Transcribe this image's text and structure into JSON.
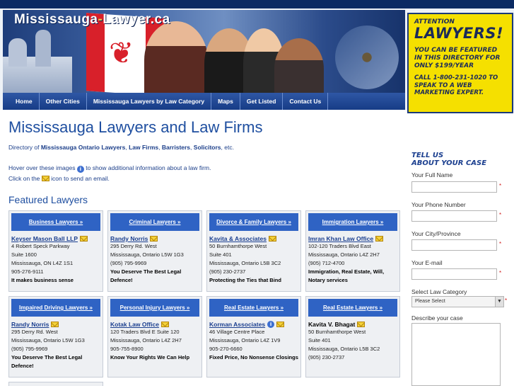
{
  "header": {
    "logo_main": "Mississauga",
    "logo_dash": "-",
    "logo_tail": "Lawyer.ca"
  },
  "ad": {
    "line1": "ATTENTION",
    "line2": "LAWYERS!",
    "line3": "YOU CAN BE FEATURED IN THIS DIRECTORY FOR ONLY $199/YEAR",
    "line4": "CALL 1-800-231-1020 TO SPEAK TO A WEB MARKETING EXPERT."
  },
  "nav": [
    "Home",
    "Other Cities",
    "Mississauga Lawyers by Law Category",
    "Maps",
    "Get Listed",
    "Contact Us"
  ],
  "main": {
    "title": "Mississauga Lawyers and Law Firms",
    "dir_prefix": "Directory of ",
    "dir_b1": "Mississauga Ontario Lawyers",
    "dir_sep1": ", ",
    "dir_b2": "Law Firms",
    "dir_sep2": ", ",
    "dir_b3": "Barristers",
    "dir_sep3": ", ",
    "dir_b4": "Solicitors",
    "dir_suffix": ", etc.",
    "hover_a": "Hover over these images",
    "hover_b": "to show additional information about a law firm.",
    "click_a": "Click on the",
    "click_b": "icon to send an email.",
    "featured": "Featured Lawyers"
  },
  "cards": [
    {
      "category": "Business Lawyers »",
      "firm": "Keyser Mason Ball LLP",
      "lines": [
        "4 Robert Speck Parkway",
        "Suite 1600",
        "Mississauga, ON L4Z 1S1",
        "905-276-9111"
      ],
      "tagline": "It makes business sense"
    },
    {
      "category": "Criminal Lawyers »",
      "firm": "Randy Norris",
      "lines": [
        "295 Derry Rd. West",
        "Mississauga, Ontario L5W 1G3",
        "(905) 795-9969"
      ],
      "tagline": "You Deserve The Best Legal Defence!"
    },
    {
      "category": "Divorce & Family Lawyers »",
      "firm": "Kavita & Associates",
      "lines": [
        "50 Burnhamthorpe West",
        "Suite 401",
        "Mississauga, Ontario L5B 3C2",
        "(905) 230-2737"
      ],
      "tagline": "Protecting the Ties that Bind"
    },
    {
      "category": "Immigration Lawyers »",
      "firm": "Imran Khan Law Office",
      "lines": [
        "102-120 Traders Blvd East",
        "Mississauga, Ontario L4Z 2H7",
        "(905) 712-4700"
      ],
      "tagline": "Immigration, Real Estate, Will, Notary services"
    },
    {
      "category": "Impaired Driving Lawyers »",
      "firm": "Randy Norris",
      "lines": [
        "295 Derry Rd. West",
        "Mississauga, Ontario L5W 1G3",
        "(905) 795-9969"
      ],
      "tagline": "You Deserve The Best Legal Defence!"
    },
    {
      "category": "Personal Injury Lawyers »",
      "firm": "Kotak Law Office",
      "lines": [
        "120 Traders Blvd E Suite 120",
        "Mississauga, Ontario L4Z 2H7",
        "905-755-8900"
      ],
      "tagline": "Know Your Rights We Can Help"
    },
    {
      "category": "Real Estate Lawyers »",
      "firm": "Korman Associates",
      "lines": [
        "46 Village Centre Place",
        "Mississauga, Ontario L4Z 1V9",
        "905-270-6660"
      ],
      "tagline": "Fixed Price, No Nonsense Closings"
    },
    {
      "category": "Real Estate Lawyers »",
      "firm": "Kavita V. Bhagat",
      "lines": [
        "50 Burnhamthorpe West",
        "Suite 401",
        "Mississauga, Ontario L5B 3C2",
        "(905) 230-2737"
      ],
      "tagline": ""
    }
  ],
  "form": {
    "heading1": "TELL US",
    "heading2": "ABOUT YOUR CASE",
    "full_name": "Your Full Name",
    "phone": "Your Phone Number",
    "city": "Your City/Province",
    "email": "Your E-mail",
    "category_label": "Select Law Category",
    "category_selected": "Please Select",
    "describe": "Describe your case",
    "required_mark": "*"
  }
}
